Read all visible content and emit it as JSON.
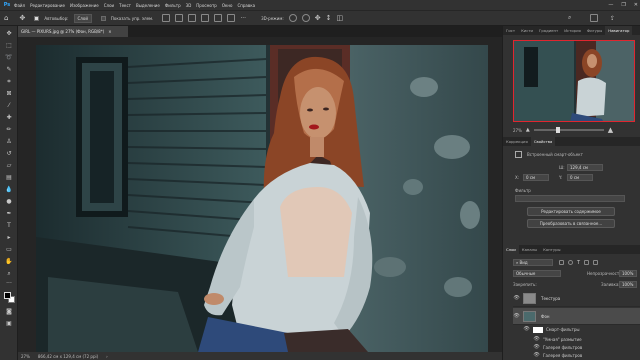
{
  "app": {
    "logo": "Ps",
    "window_controls": [
      "—",
      "❐",
      "✕"
    ]
  },
  "menu": [
    "Файл",
    "Редактирование",
    "Изображение",
    "Слои",
    "Текст",
    "Выделение",
    "Фильтр",
    "3D",
    "Просмотр",
    "Окно",
    "Справка"
  ],
  "options_bar": {
    "autoselect_label": "Автовыбор:",
    "autoselect_value": "Слой",
    "show_transform_label": "Показать упр. элем.",
    "mode_3d_label": "3D-режим:"
  },
  "document": {
    "tab_title": "GIRL — PIXURS.jpg @ 27% (Фон, RGB/8*)",
    "tab_close": "×"
  },
  "status": {
    "zoom": "27%",
    "doc_size": "866,42 см x 129,4 см (72 ppi)"
  },
  "navigator": {
    "tabs": [
      "Гист",
      "Кисти",
      "Градиент",
      "История",
      "Фигуры",
      "Навигатор"
    ],
    "active_tab": "Навигатор",
    "zoom": "27%"
  },
  "properties": {
    "tabs": [
      "Коррекция",
      "Свойства"
    ],
    "active_tab": "Свойства",
    "type_label": "Встроенный смарт-объект",
    "w_value": "129,4 см",
    "x_value": "0 см",
    "y_value": "0 см",
    "filter_label": "Фильтр",
    "btn_edit_contents": "Редактировать содержимое",
    "btn_convert_linked": "Преобразовать в связанное..."
  },
  "layers_panel": {
    "tabs": [
      "Слои",
      "Каналы",
      "Контуры"
    ],
    "active_tab": "Слои",
    "kind_label": "Вид",
    "blend_mode": "Обычные",
    "opacity_label": "Непрозрачность:",
    "opacity_value": "100%",
    "lock_label": "Закрепить:",
    "fill_label": "Заливка:",
    "fill_value": "100%",
    "layers": [
      {
        "name": "Текстура",
        "visible": true,
        "selected": false
      },
      {
        "name": "Фон",
        "visible": true,
        "selected": true
      }
    ],
    "smart_filters_label": "Смарт-фильтры",
    "filters": [
      "\"Умная\" размытие",
      "Галерея фильтров",
      "Галерея фильтров"
    ]
  },
  "colors": {
    "accent": "#31a8ff",
    "panel_bg": "#323232",
    "dark_bg": "#262626",
    "selection": "#4b4b4b",
    "nav_frame": "#e0262f"
  }
}
